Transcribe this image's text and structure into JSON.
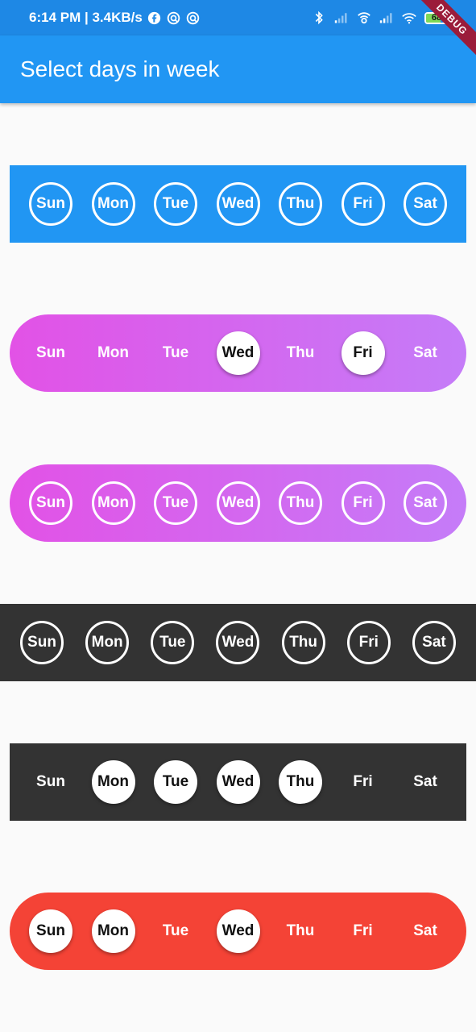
{
  "status_bar": {
    "time_speed": "6:14 PM | 3.4KB/s",
    "battery": "68",
    "battery_level_percent": 68,
    "icons": [
      "facebook-icon",
      "vpn-icon",
      "vpn-icon",
      "bluetooth-icon",
      "signal-icon",
      "wifi-calling-icon",
      "signal-icon",
      "wifi-icon",
      "battery-icon"
    ]
  },
  "debug_banner": "DEBUG",
  "app_bar": {
    "title": "Select days in week",
    "color": "#2196f3"
  },
  "rows": [
    {
      "style": "outline",
      "background": "#2196f3",
      "days": [
        {
          "label": "Sun",
          "selected": false
        },
        {
          "label": "Mon",
          "selected": false
        },
        {
          "label": "Tue",
          "selected": false
        },
        {
          "label": "Wed",
          "selected": false
        },
        {
          "label": "Thu",
          "selected": false
        },
        {
          "label": "Fri",
          "selected": false
        },
        {
          "label": "Sat",
          "selected": false
        }
      ]
    },
    {
      "style": "filled",
      "background": "gradient #e252e6 to #c57cf8",
      "days": [
        {
          "label": "Sun",
          "selected": false
        },
        {
          "label": "Mon",
          "selected": false
        },
        {
          "label": "Tue",
          "selected": false
        },
        {
          "label": "Wed",
          "selected": true
        },
        {
          "label": "Thu",
          "selected": false
        },
        {
          "label": "Fri",
          "selected": true
        },
        {
          "label": "Sat",
          "selected": false
        }
      ]
    },
    {
      "style": "outline",
      "background": "gradient #e252e6 to #c57cf8",
      "days": [
        {
          "label": "Sun",
          "selected": false
        },
        {
          "label": "Mon",
          "selected": false
        },
        {
          "label": "Tue",
          "selected": false
        },
        {
          "label": "Wed",
          "selected": false
        },
        {
          "label": "Thu",
          "selected": false
        },
        {
          "label": "Fri",
          "selected": false
        },
        {
          "label": "Sat",
          "selected": false
        }
      ]
    },
    {
      "style": "outline",
      "background": "#333333",
      "days": [
        {
          "label": "Sun",
          "selected": false
        },
        {
          "label": "Mon",
          "selected": false
        },
        {
          "label": "Tue",
          "selected": false
        },
        {
          "label": "Wed",
          "selected": false
        },
        {
          "label": "Thu",
          "selected": false
        },
        {
          "label": "Fri",
          "selected": false
        },
        {
          "label": "Sat",
          "selected": false
        }
      ]
    },
    {
      "style": "filled",
      "background": "#333333",
      "days": [
        {
          "label": "Sun",
          "selected": false
        },
        {
          "label": "Mon",
          "selected": true
        },
        {
          "label": "Tue",
          "selected": true
        },
        {
          "label": "Wed",
          "selected": true
        },
        {
          "label": "Thu",
          "selected": true
        },
        {
          "label": "Fri",
          "selected": false
        },
        {
          "label": "Sat",
          "selected": false
        }
      ]
    },
    {
      "style": "filled",
      "background": "#f44336",
      "days": [
        {
          "label": "Sun",
          "selected": true
        },
        {
          "label": "Mon",
          "selected": true
        },
        {
          "label": "Tue",
          "selected": false
        },
        {
          "label": "Wed",
          "selected": true
        },
        {
          "label": "Thu",
          "selected": false
        },
        {
          "label": "Fri",
          "selected": false
        },
        {
          "label": "Sat",
          "selected": false
        }
      ]
    }
  ]
}
